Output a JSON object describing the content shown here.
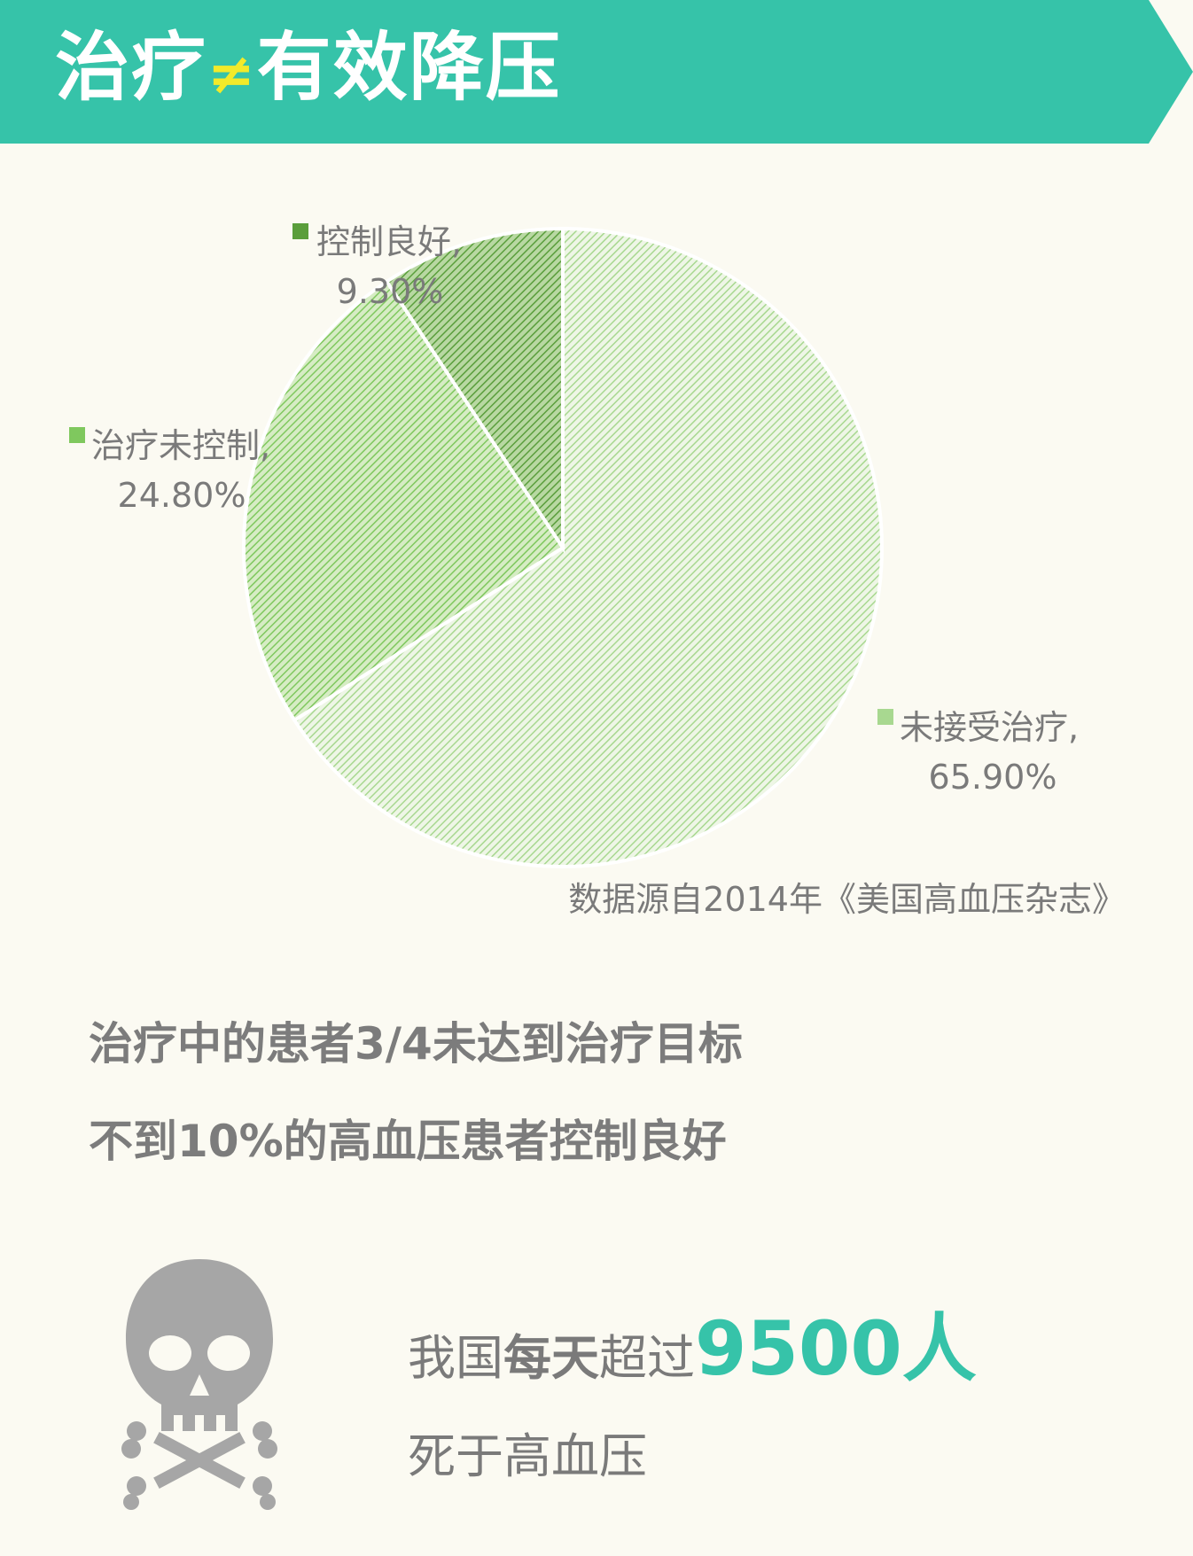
{
  "banner": {
    "title_prefix": "治疗",
    "title_neq": "≠",
    "title_suffix": "有效降压",
    "color": "#36c3a9"
  },
  "chart_data": {
    "type": "pie",
    "slices": [
      {
        "label": "未接受治疗,",
        "value": 65.9,
        "value_label": "65.90%",
        "color": "#a8d890"
      },
      {
        "label": "治疗未控制,",
        "value": 24.8,
        "value_label": "24.80%",
        "color": "#7fc85e"
      },
      {
        "label": "控制良好,",
        "value": 9.3,
        "value_label": "9.30%",
        "color": "#5a9e3c"
      }
    ],
    "legend_placement": "labels beside slices",
    "source": "数据源自2014年《美国高血压杂志》"
  },
  "headlines": [
    "治疗中的患者3/4未达到治疗目标",
    "不到10%的高血压患者控制良好"
  ],
  "death": {
    "p1": "我国",
    "p2": "每天",
    "p3": "超过",
    "number": "9500人",
    "line2": "死于高血压",
    "icon": "skull-crossbones-icon",
    "accent": "#36c3a9"
  }
}
